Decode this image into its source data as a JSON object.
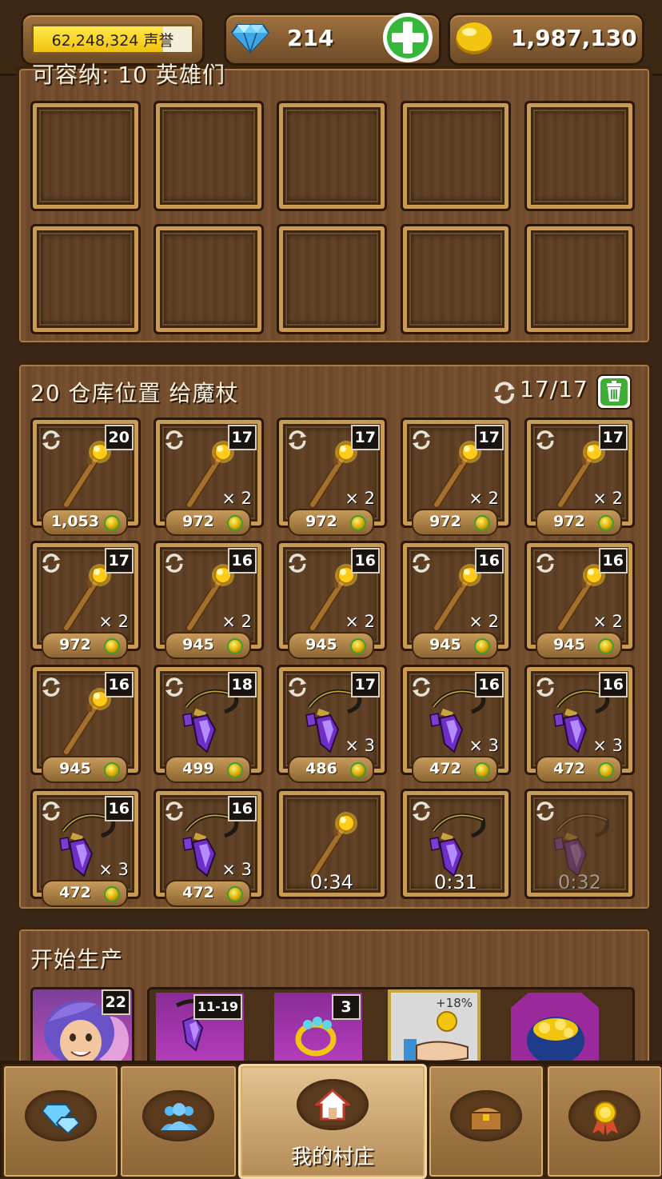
{
  "header": {
    "reputation": "62,248,324 声誉",
    "gems": "214",
    "gold": "1,987,130"
  },
  "hero_panel": {
    "title": "可容纳: 10 英雄们"
  },
  "storage": {
    "title": "20 仓库位置 给魔杖",
    "count": "17/17",
    "items": [
      {
        "type": "staff",
        "level": "20",
        "qty": "",
        "price": "1,053",
        "timer": ""
      },
      {
        "type": "staff",
        "level": "17",
        "qty": "× 2",
        "price": "972",
        "timer": ""
      },
      {
        "type": "staff",
        "level": "17",
        "qty": "× 2",
        "price": "972",
        "timer": ""
      },
      {
        "type": "staff",
        "level": "17",
        "qty": "× 2",
        "price": "972",
        "timer": ""
      },
      {
        "type": "staff",
        "level": "17",
        "qty": "× 2",
        "price": "972",
        "timer": ""
      },
      {
        "type": "staff",
        "level": "17",
        "qty": "× 2",
        "price": "972",
        "timer": ""
      },
      {
        "type": "staff",
        "level": "16",
        "qty": "× 2",
        "price": "945",
        "timer": ""
      },
      {
        "type": "staff",
        "level": "16",
        "qty": "× 2",
        "price": "945",
        "timer": ""
      },
      {
        "type": "staff",
        "level": "16",
        "qty": "× 2",
        "price": "945",
        "timer": ""
      },
      {
        "type": "staff",
        "level": "16",
        "qty": "× 2",
        "price": "945",
        "timer": ""
      },
      {
        "type": "staff",
        "level": "16",
        "qty": "",
        "price": "945",
        "timer": ""
      },
      {
        "type": "amulet",
        "level": "18",
        "qty": "",
        "price": "499",
        "timer": ""
      },
      {
        "type": "amulet",
        "level": "17",
        "qty": "× 3",
        "price": "486",
        "timer": ""
      },
      {
        "type": "amulet",
        "level": "16",
        "qty": "× 3",
        "price": "472",
        "timer": ""
      },
      {
        "type": "amulet",
        "level": "16",
        "qty": "× 3",
        "price": "472",
        "timer": ""
      },
      {
        "type": "amulet",
        "level": "16",
        "qty": "× 3",
        "price": "472",
        "timer": ""
      },
      {
        "type": "amulet",
        "level": "16",
        "qty": "× 3",
        "price": "472",
        "timer": ""
      },
      {
        "type": "staff",
        "level": "",
        "qty": "",
        "price": "",
        "timer": "0:34"
      },
      {
        "type": "amulet",
        "level": "",
        "qty": "",
        "price": "",
        "timer": "0:31"
      },
      {
        "type": "amulet-faded",
        "level": "",
        "qty": "",
        "price": "",
        "timer": "0:32"
      }
    ]
  },
  "production": {
    "title": "开始生产",
    "hero_level": "22",
    "amulet_range": "11-19",
    "ring_level": "3",
    "bonus": "+18%"
  },
  "nav": {
    "village_label": "我的村庄"
  },
  "colors": {
    "gem_blue": "#49b6f0",
    "coin_gold": "#f2c511",
    "plus_green": "#35b73a",
    "trash_green": "#3fae37"
  }
}
